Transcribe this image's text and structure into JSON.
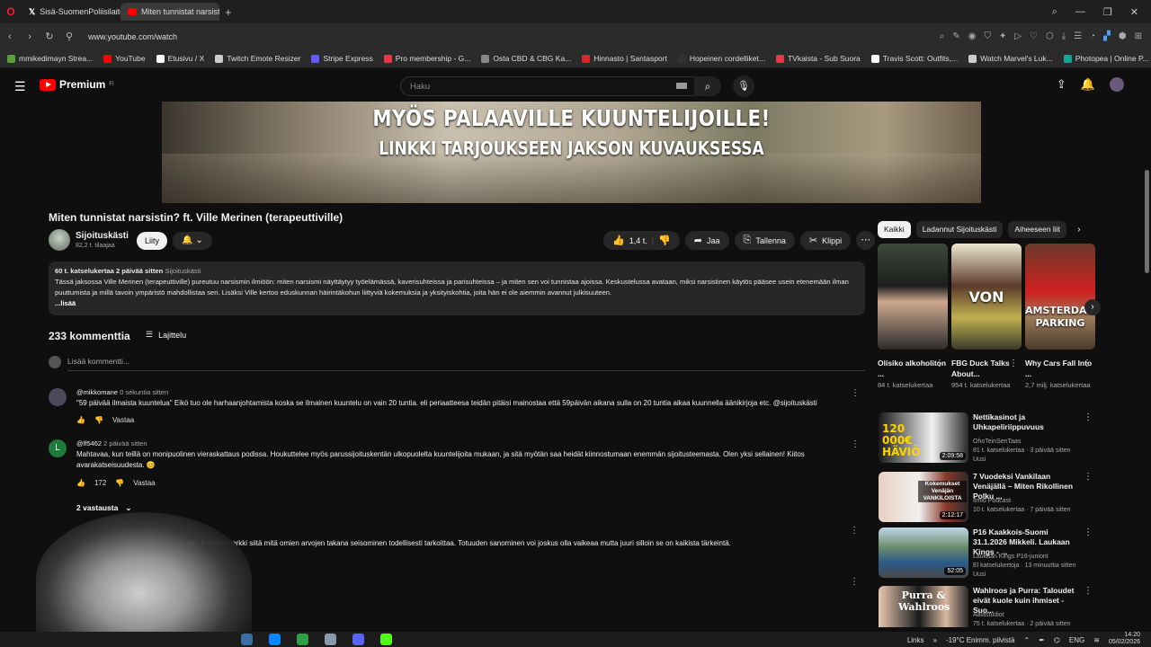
{
  "browser": {
    "tabs": [
      {
        "label": "Sisä-SuomenPoliisilaitos",
        "active": false
      },
      {
        "label": "Miten tunnistat narsisti",
        "active": true
      }
    ],
    "url": "www.youtube.com/watch",
    "bookmarks": [
      {
        "label": "mmikedimayn Strea...",
        "color": "#5a9e3c"
      },
      {
        "label": "YouTube",
        "color": "#ff0000"
      },
      {
        "label": "Etusivu / X",
        "color": "#ffffff"
      },
      {
        "label": "Twitch Emote Resizer",
        "color": "#cccccc"
      },
      {
        "label": "Stripe Express",
        "color": "#635bff"
      },
      {
        "label": "Pro membership - G...",
        "color": "#e63946"
      },
      {
        "label": "Osta CBD & CBG Ka...",
        "color": "#888888"
      },
      {
        "label": "Hinnasto | Santasport",
        "color": "#d62828"
      },
      {
        "label": "Hopeinen cordelliket...",
        "color": "#333333"
      },
      {
        "label": "TVkaista - Sub Suora",
        "color": "#e63946"
      },
      {
        "label": "Travis Scott: Outfits,...",
        "color": "#ffffff"
      },
      {
        "label": "Watch Marvel's Luk...",
        "color": "#cccccc"
      },
      {
        "label": "Photopea | Online P...",
        "color": "#18a497"
      }
    ]
  },
  "header": {
    "logo_text": "Premium",
    "logo_region": "FI",
    "search_placeholder": "Haku"
  },
  "video": {
    "overlay_line1": "MYÖS PALAAVILLE KUUNTELIJOILLE!",
    "overlay_line2": "LINKKI TARJOUKSEEN JAKSON KUVAUKSESSA",
    "title": "Miten tunnistat narsistin? ft. Ville Merinen (terapeuttiville)",
    "channel_name": "Sijoituskästi",
    "subscribers": "82,2 t. tilaajaa",
    "join_label": "Liity",
    "like_count": "1,4 t.",
    "share_label": "Jaa",
    "save_label": "Tallenna",
    "clip_label": "Klippi",
    "description": {
      "meta": "60 t. katselukertaa  2 päivää sitten",
      "tag": "Sijoituskästi",
      "text": "Tässä jaksossa Ville Merinen (terapeuttiville) pureutuu narsismin ilmiöön: miten narsismi näyttäytyy työelämässä, kaverisuhteissa ja parisuhteissa – ja miten sen voi tunnistaa ajoissa. Keskustelussa avataan, miksi narsistinen käytös pääsee usein etenemään ilman puuttumista ja millä tavoin ympäristö mahdollistaa sen. Lisäksi Ville kertoo eduskunnan häirintäkohun liittyviä kokemuksia ja yksityiskohtia, joita hän ei ole aiemmin avannut julkisuuteen.",
      "more": "...lisää"
    }
  },
  "comments": {
    "count_label": "233 kommenttia",
    "sort_label": "Lajittelu",
    "add_placeholder": "Lisää kommentti...",
    "items": [
      {
        "author": "@mikkomane",
        "time": "0 sekuntia sitten",
        "text": "\"59 päivää ilmaista kuuntelua\" Eikö tuo ole harhaanjohtamista koska se ilmainen kuuntelu on vain 20 tuntia. eli periaatteesa teidän pitäisi mainostaa että 59päivän aikana sulla on 20 tuntia aikaa kuunnella äänikirjoja etc. @sijoituskästi",
        "likes": "",
        "reply_label": "Vastaa"
      },
      {
        "author": "@lf5462",
        "time": "2 päivää sitten",
        "text": "Mahtavaa, kun teillä on monipuolinen vieraskattaus podissa. Houkuttelee myös parussijoituskentän ulkopuolelta kuuntelijoita mukaan, ja sitä myötän saa heidät kiinnostumaan enemmän sijoitusteemasta. Olen yksi sellainen! Kiitos avarakatseisuudesta. 😊",
        "likes": "172",
        "reply_label": "Vastaa",
        "avatar_letter": "L",
        "replies_label": "2 vastausta"
      },
      {
        "text": "Vil...ä on esimerkki siitä mitä omien arvojen takana seisominen todellisesti tarkoittaa. Totuuden sanominen voi joskus olla vaikeaa mutta juuri silloin se on kaikista tärkeintä."
      }
    ]
  },
  "sidebar": {
    "chips": [
      "Kaikki",
      "Ladannut Sijoituskästi",
      "Aiheeseen liit"
    ],
    "shorts": [
      {
        "title": "Olisiko alkoholiton ...",
        "views": "84 t. katselukertaa",
        "overlay": ""
      },
      {
        "title": "FBG Duck Talks About...",
        "views": "954 t. katselukertaa",
        "overlay": "VON"
      },
      {
        "title": "Why Cars Fall Into ...",
        "views": "2,7 milj. katselukertaa",
        "overlay": "AMSTERDAM PARKING"
      }
    ],
    "recommendations": [
      {
        "title": "Nettikasinot ja Uhkapeliriippuvuus",
        "channel": "OhoTeinSenTaas",
        "meta": "81 t. katselukertaa · 3 päivää sitten",
        "badge": "Uusi",
        "duration": "2:09:58",
        "thumb_text": "120 000€ HÄVIÖ"
      },
      {
        "title": "7 Vuodeksi Vankilaan Venäjällä – Miten Rikollinen Polku ...",
        "channel": "Ilmiö Podcast",
        "meta": "10 t. katselukertaa · 7 päivää sitten",
        "badge": "",
        "duration": "2:12:17",
        "thumb_text": "Kokemukset Venäjän VANKILOISTA"
      },
      {
        "title": "P16 Kaakkois-Suomi 31.1.2026 Mikkeli. Laukaan Kings - ...",
        "channel": "Laukaan Kings P16-juniorit",
        "meta": "El katselukertoja · 13 minuuttia sitten",
        "badge": "Uusi",
        "duration": "52:05",
        "thumb_text": ""
      },
      {
        "title": "Wahlroos ja Purra: Taloudet eivät kuole kuin ihmiset - Suo...",
        "channel": "Aalastudiot",
        "meta": "75 t. katselukertaa · 2 päivää sitten",
        "badge": "",
        "duration": "",
        "thumb_text": "Purra & Wahlroos"
      }
    ]
  },
  "taskbar": {
    "links_label": "Links",
    "weather": "-19°C  Enimm. pilvistä",
    "lang": "ENG",
    "time": "14.20",
    "date": "05/02/2026"
  }
}
